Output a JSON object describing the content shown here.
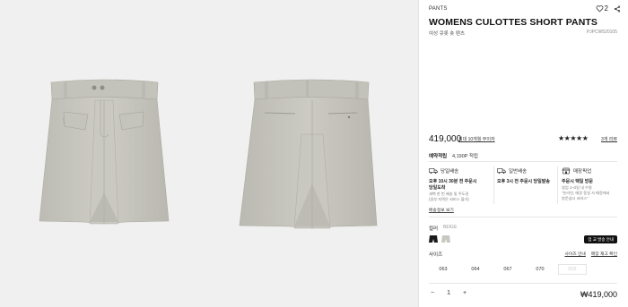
{
  "product": {
    "category": "PANTS",
    "title": "WOMENS CULOTTES SHORT PANTS",
    "subtitle": "여성 큐롯 숏 팬츠",
    "code": "PJPCW520105",
    "likes": "2",
    "price": "419,000",
    "price_link": "최대 10개월 무이자",
    "rating_stars": "★★★★★",
    "rating": 4.5,
    "review_link": "3개 리뷰",
    "colors": {
      "fabric": "#c8c7c0",
      "accent": "#111111"
    }
  },
  "points": {
    "label": "예약적립",
    "value": "4,190P 적립"
  },
  "shipping": [
    {
      "title": "당일배송",
      "icon": "truck-icon",
      "bold": "오후 10시 30분 전 주문시\n당일도착",
      "small": "새벽 한 번 배송 및 주도권\n(일부 지역은 서비스 불가)"
    },
    {
      "title": "일반배송",
      "icon": "truck-icon",
      "bold": "오후 3시 전 주문시 당일발송",
      "small": ""
    },
    {
      "title": "매장픽업",
      "icon": "store-icon",
      "bold": "주문시 택일 방문",
      "small": "영업 1~3일 내 수령\n\"온라인, 매장 동일 사 매장에서\n방문샵시 서비스\""
    }
  ],
  "more_link": "배송정보 보기",
  "color": {
    "label": "컬러",
    "value": "BEIGE"
  },
  "size_guide_button": "업 교 발송 안내",
  "size": {
    "label": "사이즈",
    "guide_link": "사이즈 안내",
    "stock_link": "매장 재고 확인",
    "options": [
      "063",
      "064",
      "067",
      "070",
      "022"
    ]
  },
  "cart": {
    "minus": "−",
    "quantity": "1",
    "plus": "+",
    "total": "₩419,000"
  }
}
